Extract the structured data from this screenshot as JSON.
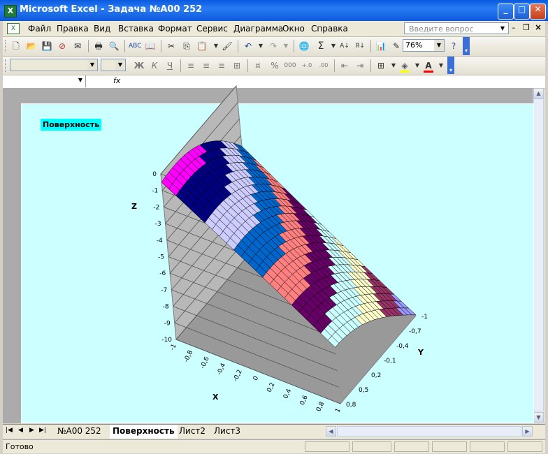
{
  "window": {
    "title": "Microsoft Excel - Задача №А00 252",
    "app_icon_letter": "X"
  },
  "menu": {
    "items": [
      "Файл",
      "Правка",
      "Вид",
      "Вставка",
      "Формат",
      "Сервис",
      "Диаграмма",
      "Окно",
      "Справка"
    ],
    "ask_placeholder": "Введите вопрос"
  },
  "toolbar": {
    "zoom": "76%",
    "sigma": "Σ"
  },
  "format_toolbar": {
    "bold": "Ж",
    "italic": "К",
    "underline": "Ч",
    "percent": "%",
    "thousands": "000",
    "font_color_letter": "A"
  },
  "formula_bar": {
    "fx": "fx"
  },
  "chart": {
    "title": "Поверхность",
    "z_label": "Z",
    "x_label": "X",
    "y_label": "Y",
    "z_ticks": [
      "0",
      "-1",
      "-2",
      "-3",
      "-4",
      "-5",
      "-6",
      "-7",
      "-8",
      "-9",
      "-10"
    ],
    "x_ticks": [
      "-1",
      "-0,8",
      "-0,6",
      "-0,4",
      "-0,2",
      "0",
      "0,2",
      "0,4",
      "0,6",
      "0,8",
      "1"
    ],
    "y_ticks": [
      "0,8",
      "0,5",
      "0,2",
      "-0,1",
      "-0,4",
      "-0,7",
      "-1"
    ]
  },
  "chart_data": {
    "type": "surface",
    "title": "Поверхность",
    "xlabel": "X",
    "ylabel": "Y",
    "zlabel": "Z",
    "xlim": [
      -1,
      1
    ],
    "ylim": [
      -1,
      0.8
    ],
    "zlim": [
      -10,
      0
    ],
    "x_ticks": [
      -1,
      -0.8,
      -0.6,
      -0.4,
      -0.2,
      0,
      0.2,
      0.4,
      0.6,
      0.8,
      1
    ],
    "y_ticks": [
      0.8,
      0.5,
      0.2,
      -0.1,
      -0.4,
      -0.7,
      -1
    ],
    "z_ticks": [
      0,
      -1,
      -2,
      -3,
      -4,
      -5,
      -6,
      -7,
      -8,
      -9,
      -10
    ],
    "band_colors": [
      "#9999ff",
      "#993366",
      "#ffffcc",
      "#ccffff",
      "#660066",
      "#ff8080",
      "#0066cc",
      "#ccccff",
      "#000080",
      "#ff00ff"
    ]
  },
  "sheets": {
    "tabs": [
      "№А00 252",
      "Поверхность",
      "Лист2",
      "Лист3"
    ],
    "active": "Поверхность"
  },
  "status": {
    "text": "Готово"
  }
}
